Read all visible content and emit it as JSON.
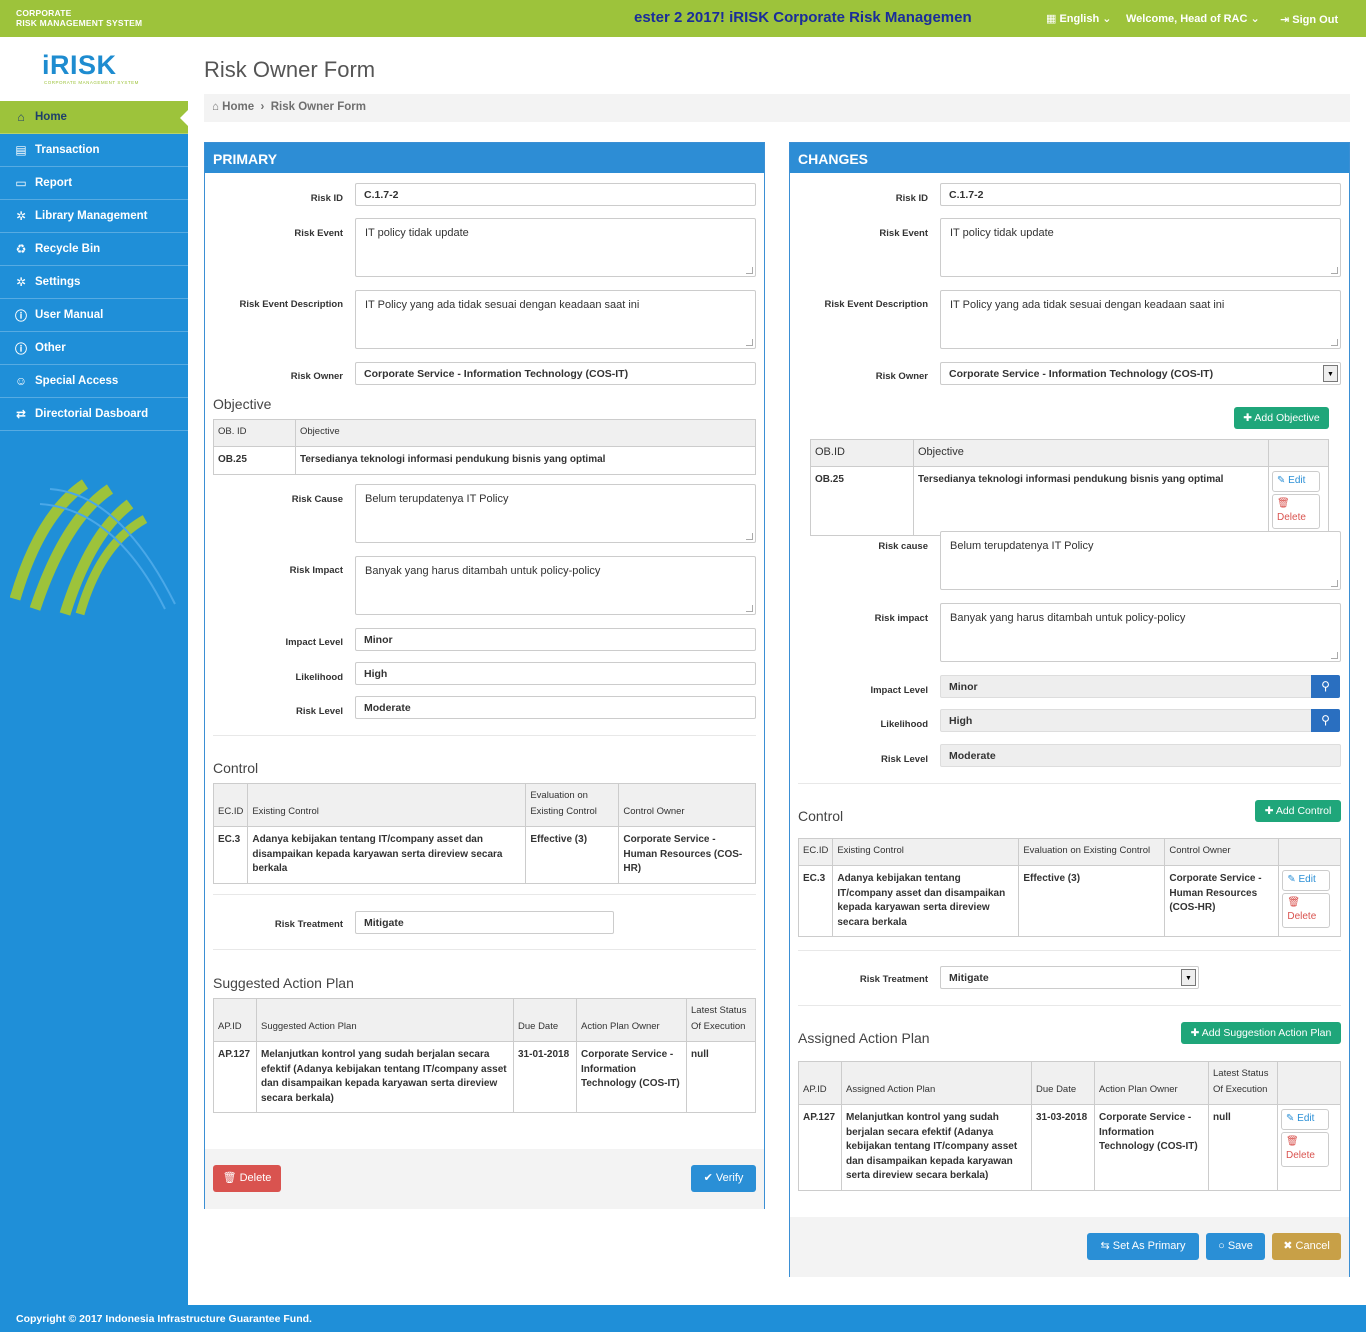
{
  "topbar": {
    "brand_line1": "CORPORATE",
    "brand_line2": "RISK MANAGEMENT SYSTEM",
    "marquee": "ester 2 2017! iRISK Corporate Risk Managemen",
    "language": "English",
    "welcome": "Welcome, Head of RAC",
    "signout": "Sign Out"
  },
  "sidebar": {
    "logo_text": "iRISK",
    "logo_sub": "CORPORATE MANAGEMENT SYSTEM",
    "items": [
      {
        "label": "Home",
        "icon": "home-icon"
      },
      {
        "label": "Transaction",
        "icon": "book-icon"
      },
      {
        "label": "Report",
        "icon": "folder-icon"
      },
      {
        "label": "Library Management",
        "icon": "gear-icon"
      },
      {
        "label": "Recycle Bin",
        "icon": "recycle-icon"
      },
      {
        "label": "Settings",
        "icon": "gear-icon"
      },
      {
        "label": "User Manual",
        "icon": "info-icon"
      },
      {
        "label": "Other",
        "icon": "info-icon"
      },
      {
        "label": "Special Access",
        "icon": "user-icon"
      },
      {
        "label": "Directorial Dasboard",
        "icon": "exchange-icon"
      }
    ]
  },
  "page": {
    "title": "Risk Owner Form",
    "breadcrumb_home": "Home",
    "breadcrumb_current": "Risk Owner Form"
  },
  "labels": {
    "risk_id": "Risk ID",
    "risk_event": "Risk Event",
    "risk_event_desc": "Risk Event Description",
    "risk_owner": "Risk Owner",
    "risk_cause_p": "Risk Cause",
    "risk_impact_p": "Risk Impact",
    "risk_cause_c": "Risk cause",
    "risk_impact_c": "Risk impact",
    "impact_level": "Impact Level",
    "likelihood": "Likelihood",
    "risk_level": "Risk Level",
    "risk_treatment": "Risk Treatment"
  },
  "primary": {
    "header": "PRIMARY",
    "risk_id": "C.1.7-2",
    "risk_event": "IT policy tidak update",
    "risk_event_desc": "IT Policy yang ada tidak sesuai dengan keadaan saat ini",
    "risk_owner": "Corporate Service - Information Technology (COS-IT)",
    "objective_title": "Objective",
    "objective_headers": [
      "OB. ID",
      "Objective"
    ],
    "objective_rows": [
      [
        "OB.25",
        "Tersedianya teknologi informasi pendukung bisnis yang optimal"
      ]
    ],
    "risk_cause": "Belum terupdatenya IT Policy",
    "risk_impact": "Banyak yang harus ditambah untuk policy-policy",
    "impact_level": "Minor",
    "likelihood": "High",
    "risk_level": "Moderate",
    "control_title": "Control",
    "control_headers": [
      "EC.ID",
      "Existing Control",
      "Evaluation on Existing Control",
      "Control Owner"
    ],
    "control_rows": [
      [
        "EC.3",
        "Adanya kebijakan tentang IT/company asset dan disampaikan kepada karyawan serta direview secara berkala",
        "Effective (3)",
        "Corporate Service - Human Resources (COS-HR)"
      ]
    ],
    "risk_treatment": "Mitigate",
    "action_title": "Suggested Action Plan",
    "action_headers": [
      "AP.ID",
      "Suggested Action Plan",
      "Due Date",
      "Action Plan Owner",
      "Latest Status Of Execution"
    ],
    "action_rows": [
      [
        "AP.127",
        "Melanjutkan kontrol yang sudah berjalan secara efektif (Adanya kebijakan tentang IT/company asset dan disampaikan kepada karyawan serta direview secara berkala)",
        "31-01-2018",
        "Corporate Service - Information Technology (COS-IT)",
        "null"
      ]
    ],
    "delete_btn": "Delete",
    "verify_btn": "Verify"
  },
  "changes": {
    "header": "CHANGES",
    "risk_id": "C.1.7-2",
    "risk_event": "IT policy tidak update",
    "risk_event_desc": "IT Policy yang ada tidak sesuai dengan keadaan saat ini",
    "risk_owner": "Corporate Service - Information Technology (COS-IT)",
    "add_objective": "Add Objective",
    "objective_headers": [
      "OB.ID",
      "Objective"
    ],
    "objective_rows": [
      [
        "OB.25",
        "Tersedianya teknologi informasi pendukung bisnis yang optimal"
      ]
    ],
    "edit": "Edit",
    "delete": "Delete",
    "risk_cause": "Belum terupdatenya IT Policy",
    "risk_impact": "Banyak yang harus ditambah untuk policy-policy",
    "impact_level": "Minor",
    "likelihood": "High",
    "risk_level": "Moderate",
    "control_title": "Control",
    "add_control": "Add Control",
    "control_headers": [
      "EC.ID",
      "Existing Control",
      "Evaluation on Existing Control",
      "Control Owner"
    ],
    "control_rows": [
      [
        "EC.3",
        "Adanya kebijakan tentang IT/company asset dan disampaikan kepada karyawan serta direview secara berkala",
        "Effective (3)",
        "Corporate Service - Human Resources (COS-HR)"
      ]
    ],
    "risk_treatment": "Mitigate",
    "action_title": "Assigned Action Plan",
    "add_action": "Add Suggestion Action Plan",
    "action_headers": [
      "AP.ID",
      "Assigned Action Plan",
      "Due Date",
      "Action Plan Owner",
      "Latest Status Of Execution"
    ],
    "action_rows": [
      [
        "AP.127",
        "Melanjutkan kontrol yang sudah berjalan secara efektif (Adanya kebijakan tentang IT/company asset dan disampaikan kepada karyawan serta direview secara berkala)",
        "31-03-2018",
        "Corporate Service - Information Technology (COS-IT)",
        "null"
      ]
    ],
    "set_primary_btn": "Set As Primary",
    "save_btn": "Save",
    "cancel_btn": "Cancel"
  },
  "footer": "Copyright © 2017 Indonesia Infrastructure Guarantee Fund.",
  "colors": {
    "topbar": "#9dc33b",
    "sidebar": "#1f8fd8",
    "panel_header": "#2d8dd5",
    "green_button": "#1fa67a",
    "red_button": "#d9534f",
    "cancel_button": "#c8a047"
  }
}
